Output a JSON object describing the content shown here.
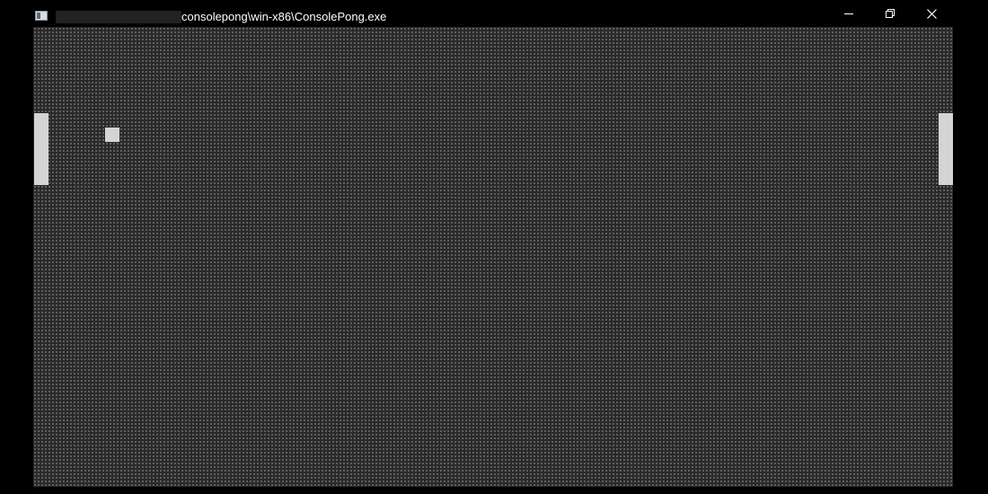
{
  "window": {
    "title": "consolepong\\win-x86\\ConsolePong.exe",
    "icon": "console-app-icon",
    "buttons": [
      "minimize",
      "restore",
      "close"
    ]
  },
  "game": {
    "left_paddle": "left-paddle",
    "right_paddle": "right-paddle",
    "ball": "ball"
  },
  "colors": {
    "window_bg": "#000000",
    "console_bg": "#2a2a2a",
    "sprite": "#d4d4d4",
    "title_text": "#ffffff"
  }
}
